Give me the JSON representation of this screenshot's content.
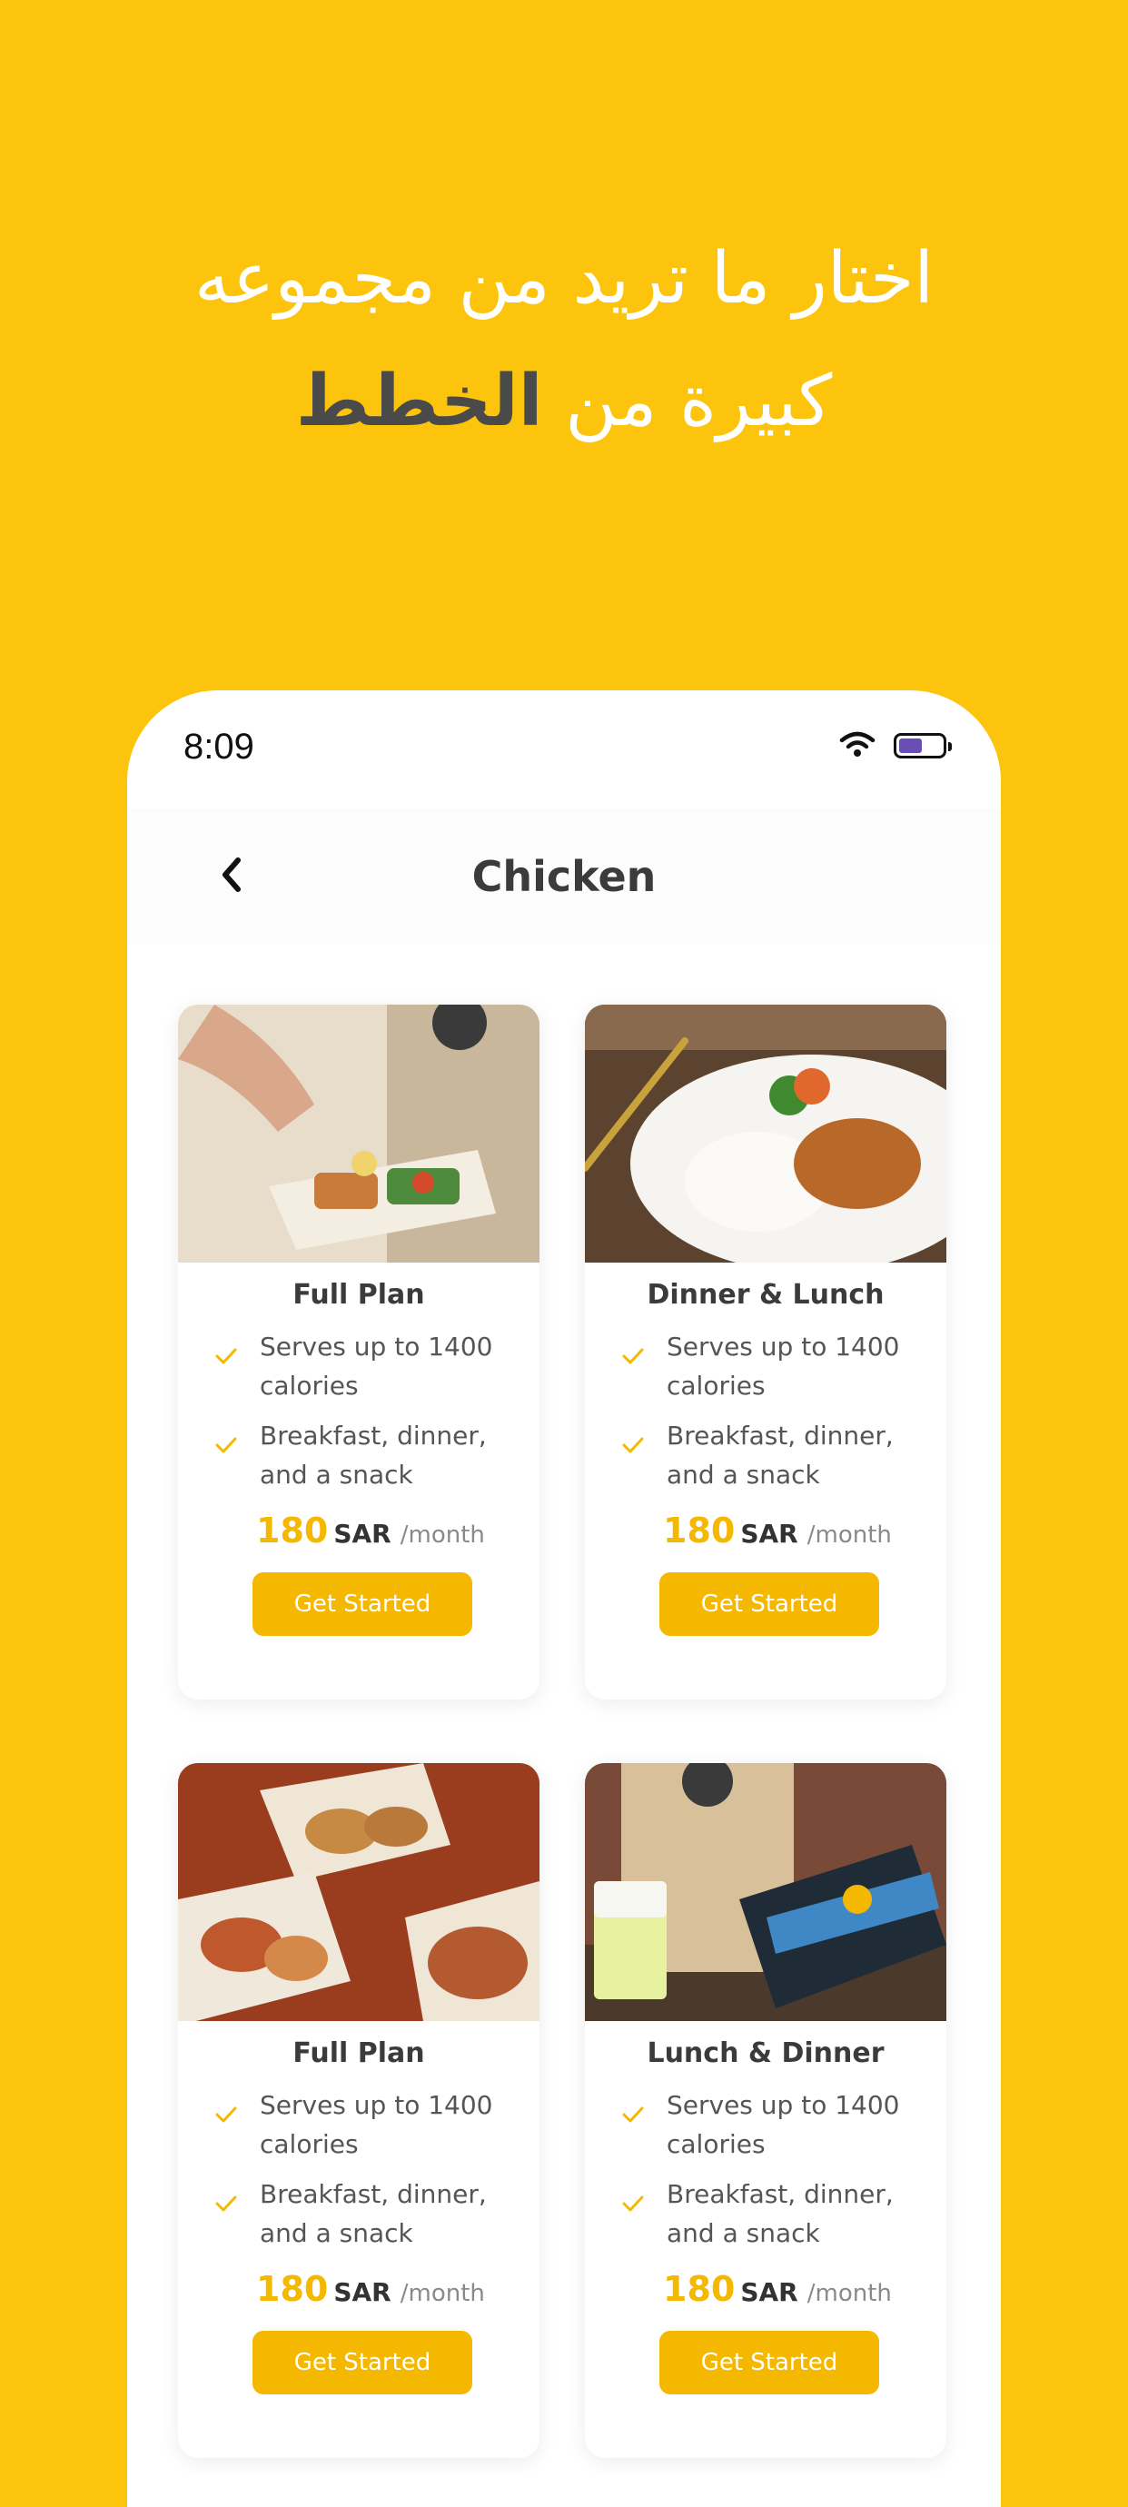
{
  "promo": {
    "line1": "اختار ما تريد من مجموعه",
    "line2_plain": "كبيرة من",
    "line2_bold": "الخطط"
  },
  "status_bar": {
    "time": "8:09",
    "icons": [
      "wifi-icon",
      "battery-icon"
    ],
    "battery_level": 0.55,
    "battery_color": "#6b4eb3"
  },
  "nav": {
    "back_icon": "chevron-left-icon",
    "title": "Chicken"
  },
  "colors": {
    "background": "#FCC40D",
    "accent": "#F5B800",
    "text_dark": "#3b3b3b"
  },
  "plans": [
    {
      "image": "meal-photo",
      "title": "Full Plan",
      "features": [
        "Serves up to 1400 calories",
        "Breakfast, dinner, and a snack"
      ],
      "price": "180",
      "currency": "SAR",
      "period": "/month",
      "cta": "Get Started"
    },
    {
      "image": "meal-photo",
      "title": "Dinner & Lunch",
      "features": [
        "Serves up to 1400 calories",
        "Breakfast, dinner, and a snack"
      ],
      "price": "180",
      "currency": "SAR",
      "period": "/month",
      "cta": "Get Started"
    },
    {
      "image": "meal-photo",
      "title": "Full Plan",
      "features": [
        "Serves up to 1400 calories",
        "Breakfast, dinner, and a snack"
      ],
      "price": "180",
      "currency": "SAR",
      "period": "/month",
      "cta": "Get Started"
    },
    {
      "image": "meal-photo",
      "title": "Lunch & Dinner",
      "features": [
        "Serves up to 1400 calories",
        "Breakfast, dinner, and a snack"
      ],
      "price": "180",
      "currency": "SAR",
      "period": "/month",
      "cta": "Get Started"
    }
  ]
}
